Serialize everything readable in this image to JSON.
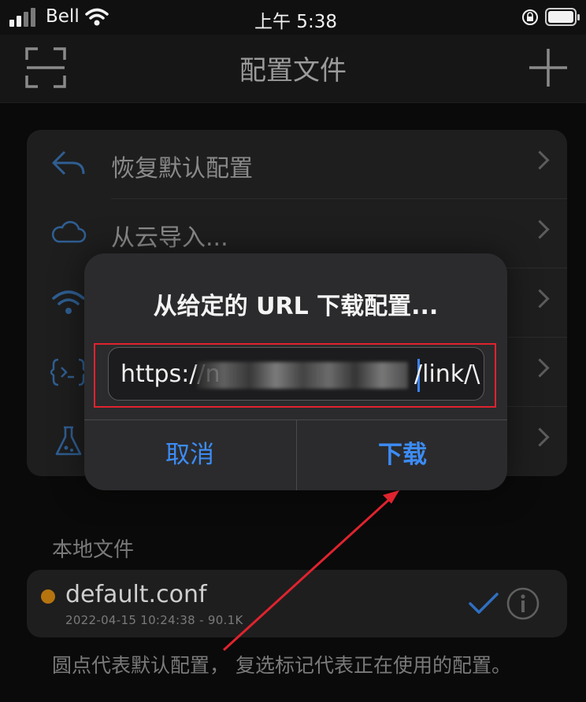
{
  "status_bar": {
    "carrier": "Bell",
    "time": "上午 5:38"
  },
  "nav": {
    "title": "配置文件",
    "left_icon": "scan-icon",
    "right_icon": "plus-icon"
  },
  "menu": {
    "items": [
      {
        "label": "恢复默认配置",
        "icon": "undo-arrow-icon"
      },
      {
        "label": "从云导入...",
        "icon": "cloud-icon"
      },
      {
        "label": "",
        "icon": "wifi-icon"
      },
      {
        "label": "",
        "icon": "code-braces-icon"
      },
      {
        "label": "",
        "icon": "flask-icon"
      }
    ]
  },
  "local": {
    "section_title": "本地文件",
    "file": {
      "name": "default.conf",
      "meta": "2022-04-15 10:24:38 - 90.1K",
      "dot_color": "#b6740f"
    },
    "footnote": "圆点代表默认配置， 复选标记代表正在使用的配置。"
  },
  "dialog": {
    "title": "从给定的 URL 下载配置...",
    "input_prefix": "https://n",
    "input_suffix": "/link/\\",
    "cancel_label": "取消",
    "confirm_label": "下载"
  },
  "colors": {
    "accent": "#3c8cf5",
    "highlight_box": "#e0232e",
    "annotation_arrow": "#e0232e"
  }
}
